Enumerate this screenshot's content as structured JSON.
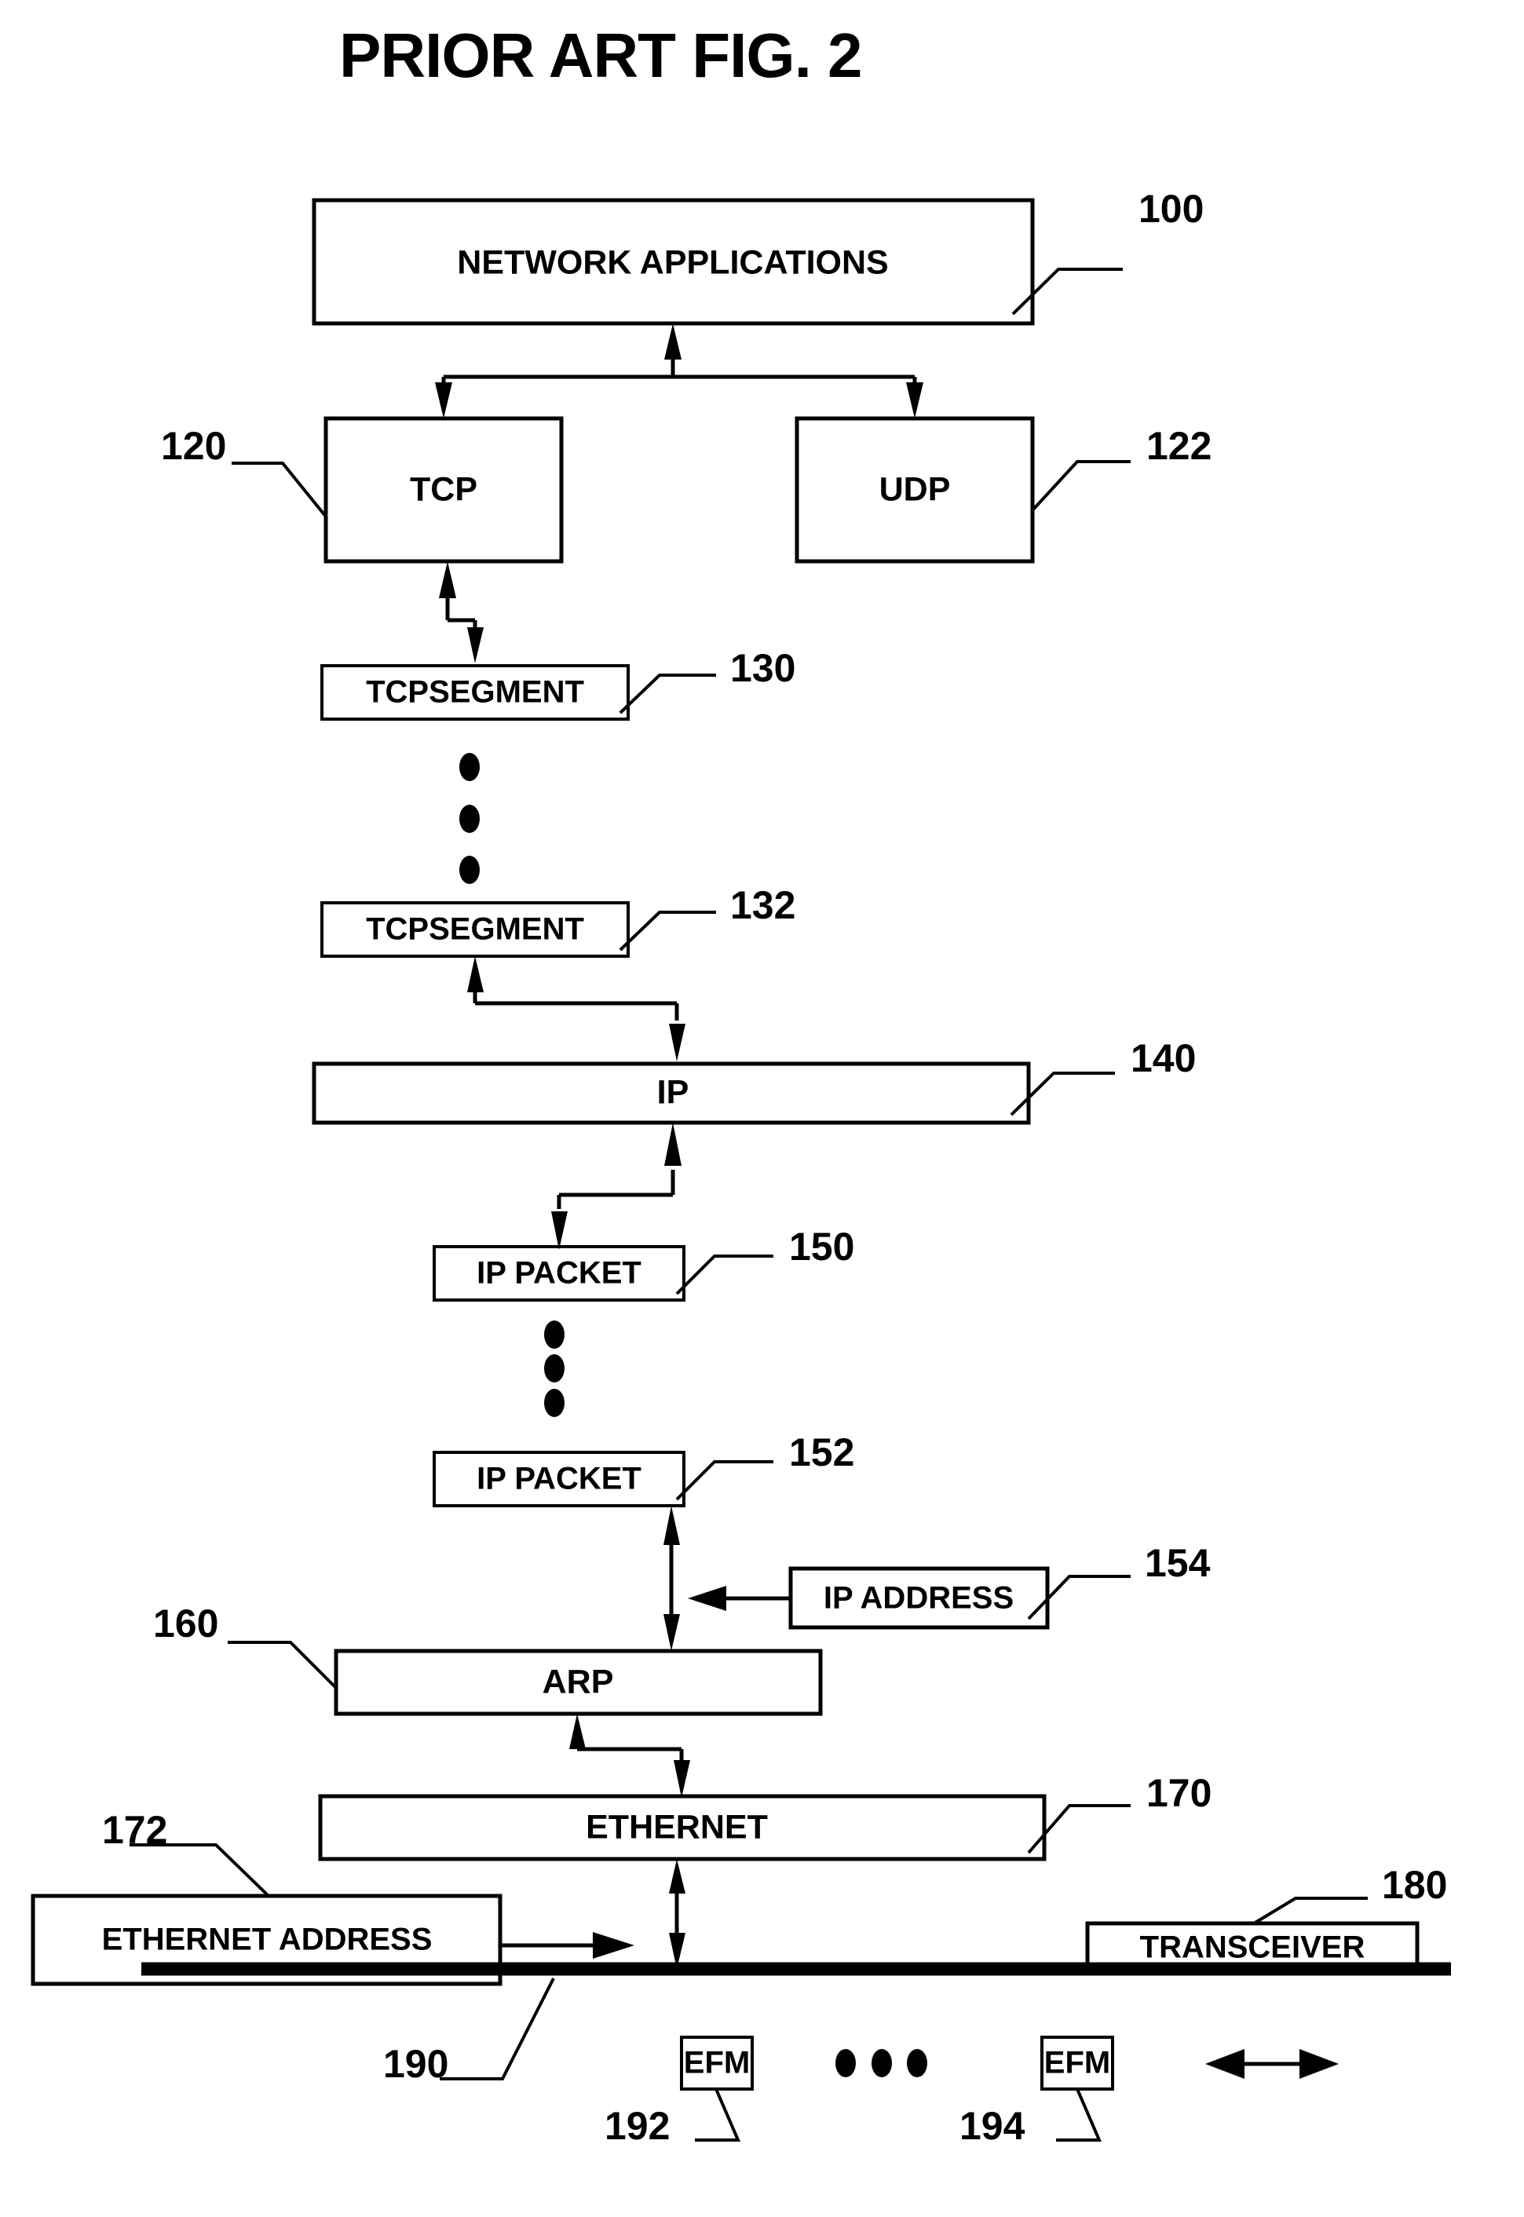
{
  "figure": {
    "title": "PRIOR ART FIG. 2",
    "type": "patent-block-diagram"
  },
  "blocks": {
    "network_applications": {
      "label": "NETWORK APPLICATIONS",
      "ref": "100"
    },
    "tcp": {
      "label": "TCP",
      "ref": "120"
    },
    "udp": {
      "label": "UDP",
      "ref": "122"
    },
    "tcp_segment_1": {
      "label": "TCPSEGMENT",
      "ref": "130"
    },
    "tcp_segment_2": {
      "label": "TCPSEGMENT",
      "ref": "132"
    },
    "ip": {
      "label": "IP",
      "ref": "140"
    },
    "ip_packet_1": {
      "label": "IP PACKET",
      "ref": "150"
    },
    "ip_packet_2": {
      "label": "IP PACKET",
      "ref": "152"
    },
    "ip_address": {
      "label": "IP ADDRESS",
      "ref": "154"
    },
    "arp": {
      "label": "ARP",
      "ref": "160"
    },
    "ethernet": {
      "label": "ETHERNET",
      "ref": "170"
    },
    "ethernet_address": {
      "label": "ETHERNET ADDRESS",
      "ref": "172"
    },
    "transceiver": {
      "label": "TRANSCEIVER",
      "ref": "180"
    },
    "bus": {
      "label": "",
      "ref": "190"
    },
    "efm_1": {
      "label": "EFM",
      "ref": "192"
    },
    "efm_2": {
      "label": "EFM",
      "ref": "194"
    }
  },
  "ellipsis_markers": [
    {
      "name": "tcp-segment-ellipsis",
      "orientation": "vertical",
      "count": 3
    },
    {
      "name": "ip-packet-ellipsis",
      "orientation": "vertical",
      "count": 3
    },
    {
      "name": "efm-ellipsis",
      "orientation": "horizontal",
      "count": 3
    }
  ],
  "colors": {
    "ink": "#000000",
    "paper": "#ffffff"
  }
}
